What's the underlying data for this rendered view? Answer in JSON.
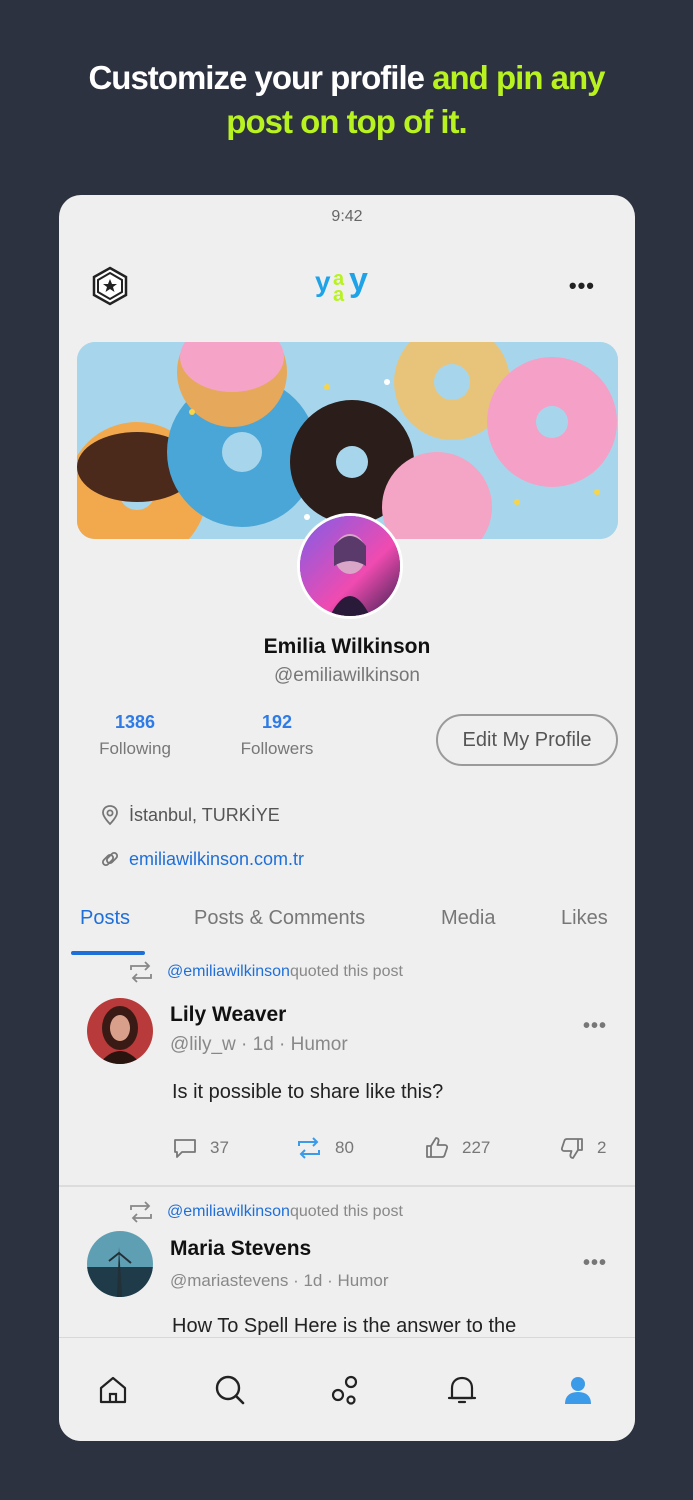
{
  "headline": {
    "part1": "Customize your profile",
    "part2": " and pin any",
    "part3": "post on top of it."
  },
  "status": {
    "time": "9:42"
  },
  "header": {
    "logo_text": "yaay",
    "more_label": "•••"
  },
  "profile": {
    "name": "Emilia Wilkinson",
    "handle": "@emiliawilkinson",
    "following_count": "1386",
    "following_label": "Following",
    "followers_count": "192",
    "followers_label": "Followers",
    "edit_label": "Edit My Profile",
    "location": "İstanbul, TURKİYE",
    "website": "emiliawilkinson.com.tr"
  },
  "tabs": [
    {
      "label": "Posts",
      "active": true
    },
    {
      "label": "Posts & Comments",
      "active": false
    },
    {
      "label": "Media",
      "active": false
    },
    {
      "label": "Likes",
      "active": false
    }
  ],
  "posts": [
    {
      "quoted_user": "@emiliawilkinson",
      "quoted_text": " quoted this post",
      "name": "Lily Weaver",
      "meta": "@lily_w · 1d ·  Humor",
      "text": "Is it possible to share like this?",
      "comments": "37",
      "reposts": "80",
      "likes": "227",
      "dislikes": "2",
      "more_label": "•••"
    },
    {
      "quoted_user": "@emiliawilkinson",
      "quoted_text": " quoted this post",
      "name": "Maria Stevens",
      "meta": "@mariastevens · 1d ·  Humor",
      "text": "How To Spell Here is the answer to the",
      "more_label": "•••"
    }
  ],
  "colors": {
    "background": "#2d3240",
    "accent_green": "#b8f21f",
    "link_blue": "#1f6fd8",
    "card": "#efefef"
  },
  "nav": [
    "home-icon",
    "search-icon",
    "discover-icon",
    "bell-icon",
    "profile-icon"
  ]
}
